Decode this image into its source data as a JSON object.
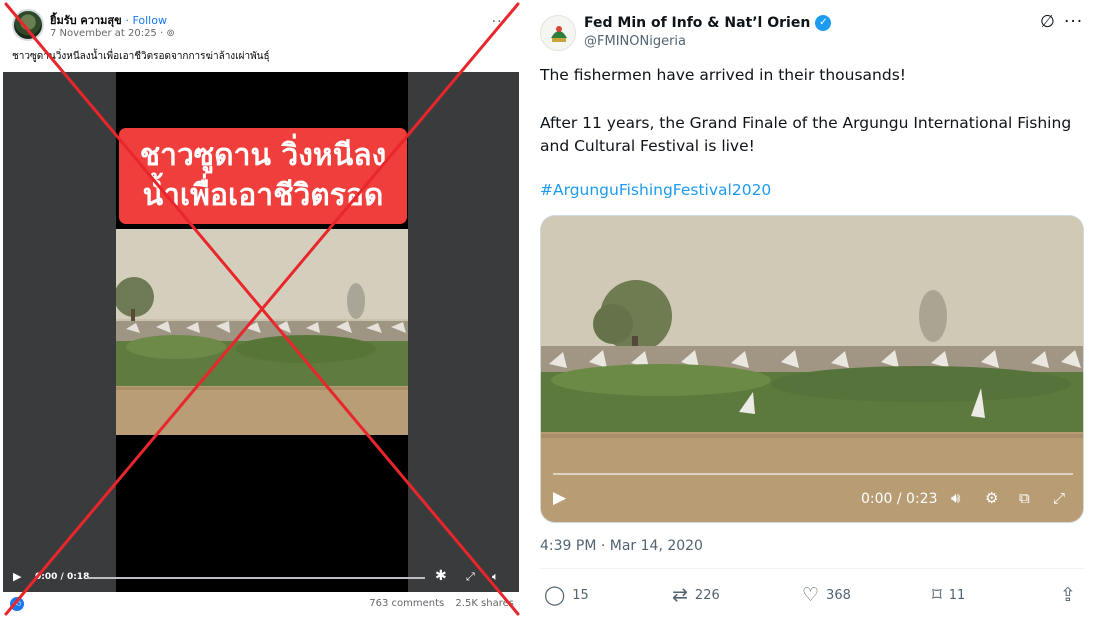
{
  "facebook": {
    "author_name": "ยิ้มรับ ความสุข",
    "follow_label": "· Follow",
    "timestamp": "7 November at 20:25 · ",
    "globe_glyph": "⊚",
    "caption": "ชาวซูดานวิ่งหนีลงน้ำเพื่อเอาชีวิตรอดจากการฆ่าล้างเผ่าพันธุ์",
    "banner_line1": "ชาวซูดาน วิ่งหนีลง",
    "banner_line2": "น้ำเพื่อเอาชีวิตรอด",
    "video_time": "0:00 / 0:18",
    "comments": "763 comments",
    "shares": "2.5K shares",
    "more_glyph": "···",
    "play_glyph": "▶",
    "gear_glyph": "✱",
    "expand_glyph": "⤢",
    "volume_glyph": "🔈︎",
    "like_glyph": "👍︎",
    "cross_color": "#e8262b"
  },
  "twitter": {
    "display_name": "Fed Min of Info & Nat’l Orien",
    "handle": "@FMINONigeria",
    "verified_glyph": "✓",
    "grok_glyph": "∅",
    "more_glyph": "···",
    "line1": "The fishermen have arrived in their thousands!",
    "line2": "After 11 years, the Grand Finale of the Argungu International Fishing and Cultural Festival is live!",
    "hashtag": "#ArgunguFishingFestival2020",
    "video_time": "0:00 / 0:23",
    "play_glyph": "▶",
    "volume_glyph": "🔊︎",
    "settings_glyph": "⚙",
    "pip_glyph": "⧉",
    "fullscreen_glyph": "⤢",
    "posted_at": "4:39 PM · Mar 14, 2020",
    "replies": "15",
    "reposts": "226",
    "likes": "368",
    "bookmarks": "11",
    "reply_glyph": "◯",
    "repost_glyph": "⇄",
    "like_glyph": "♡",
    "bookmark_glyph": "⌑",
    "share_glyph": "⇪",
    "accent_color": "#1d9bf0"
  }
}
